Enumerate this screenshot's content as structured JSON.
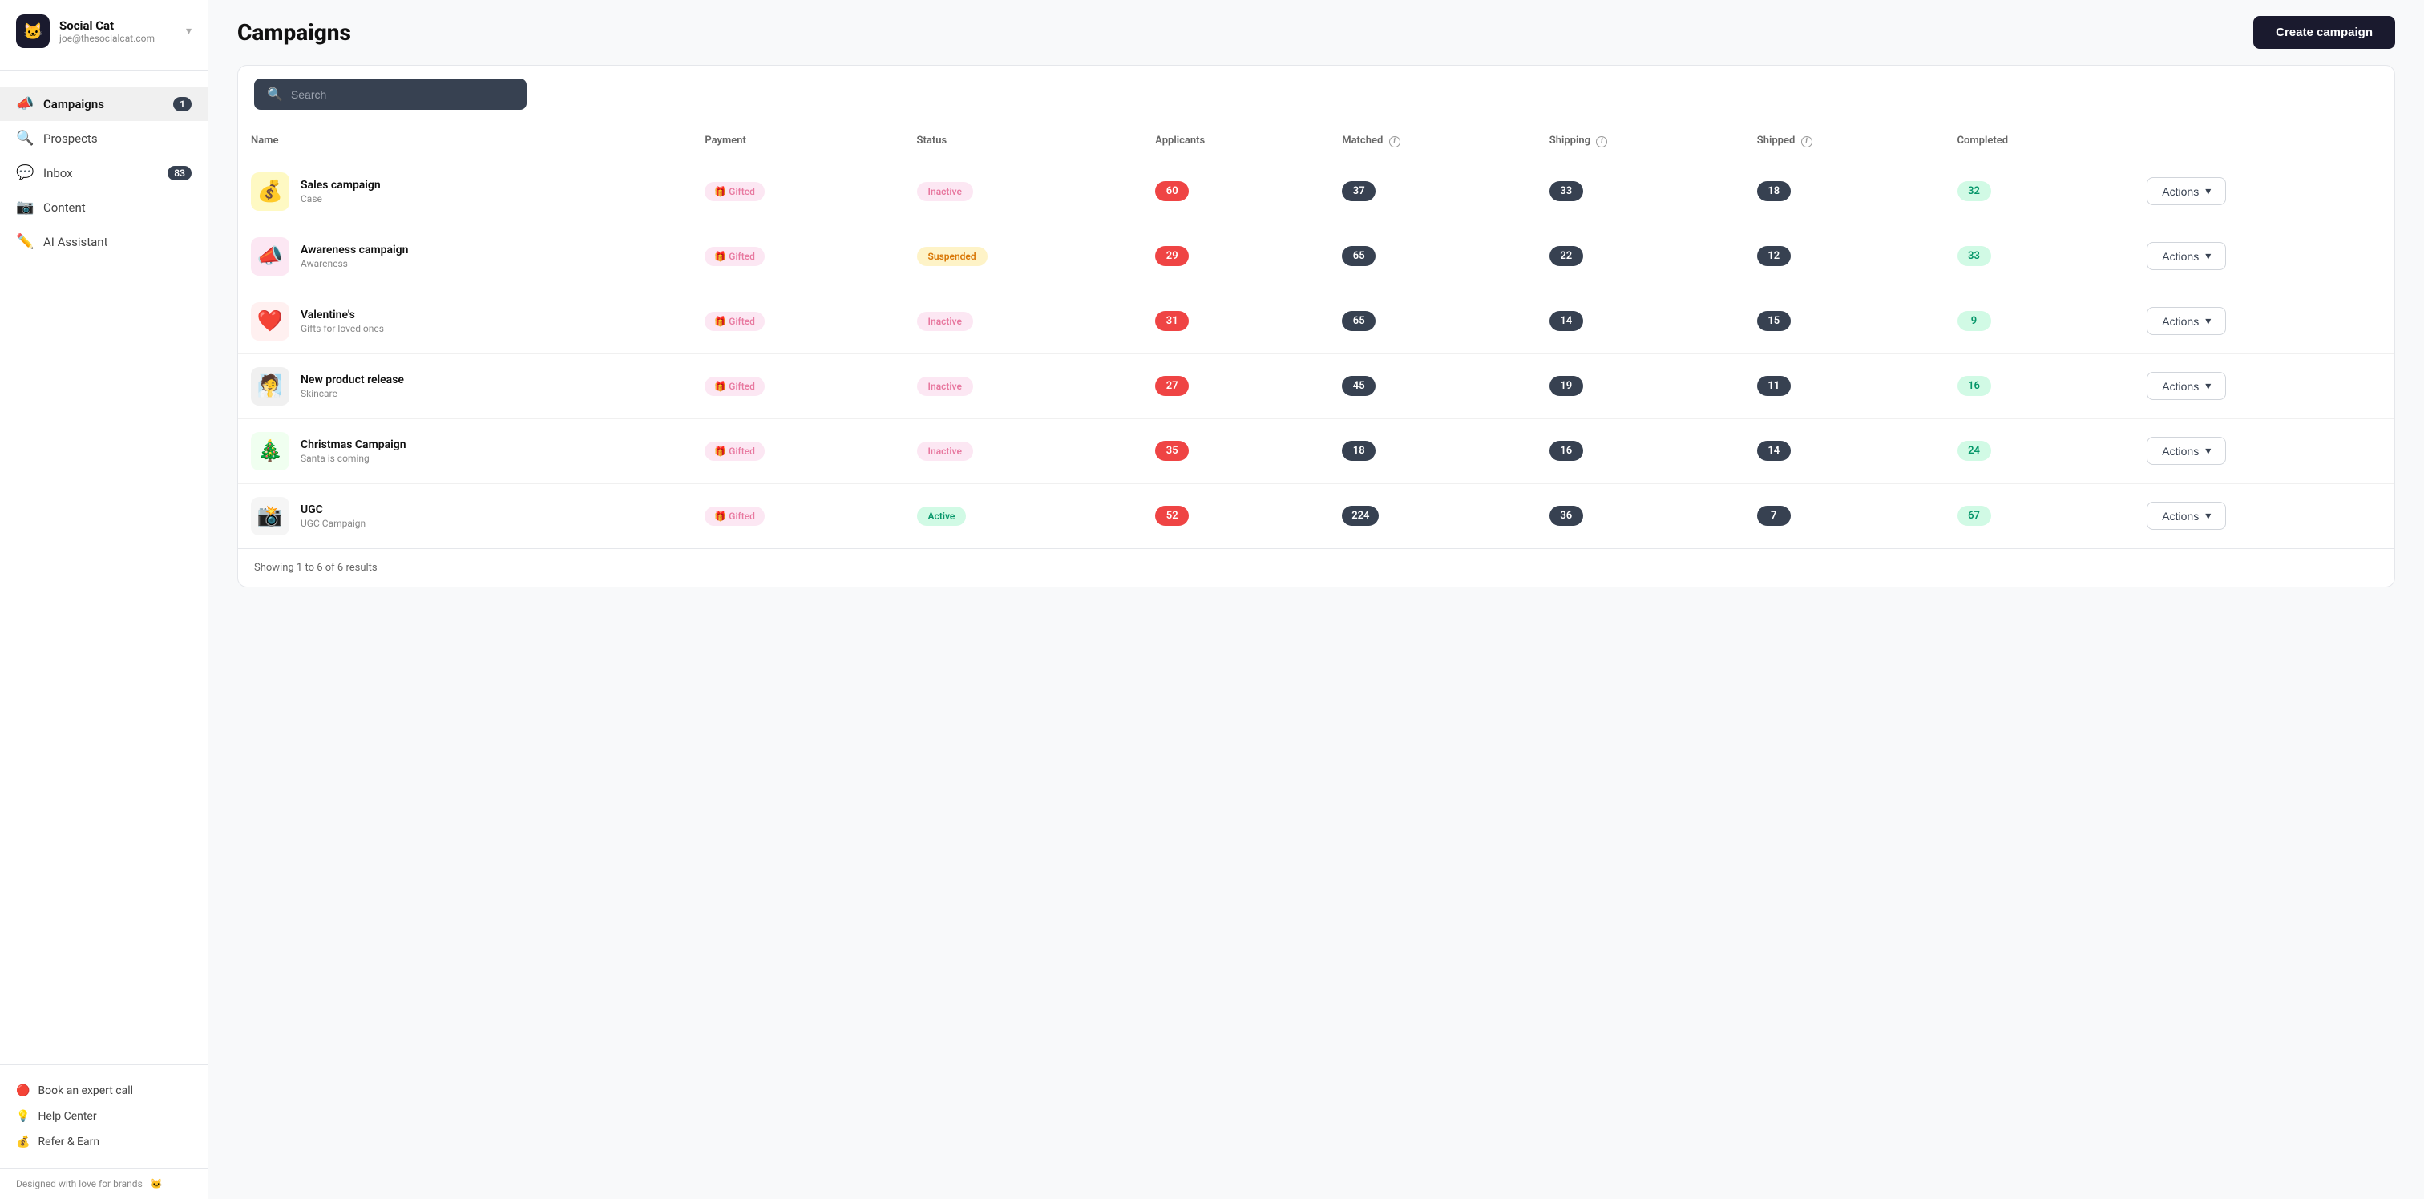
{
  "app": {
    "name": "Social Cat",
    "email": "joe@thesocialcat.com",
    "logo_emoji": "🐱"
  },
  "sidebar": {
    "nav_items": [
      {
        "id": "campaigns",
        "label": "Campaigns",
        "icon": "📣",
        "badge": "1",
        "active": true
      },
      {
        "id": "prospects",
        "label": "Prospects",
        "icon": "🔍",
        "badge": null,
        "active": false
      },
      {
        "id": "inbox",
        "label": "Inbox",
        "icon": "💬",
        "badge": "83",
        "active": false
      },
      {
        "id": "content",
        "label": "Content",
        "icon": "📷",
        "badge": null,
        "active": false
      },
      {
        "id": "ai-assistant",
        "label": "AI Assistant",
        "icon": "✏️",
        "badge": null,
        "active": false
      }
    ],
    "bottom_items": [
      {
        "id": "book-call",
        "label": "Book an expert call",
        "icon": "🔴"
      },
      {
        "id": "help",
        "label": "Help Center",
        "icon": "💡"
      },
      {
        "id": "refer",
        "label": "Refer & Earn",
        "icon": "💰"
      }
    ],
    "footer_text": "Designed with love for brands",
    "footer_icon": "🐱"
  },
  "header": {
    "title": "Campaigns",
    "create_btn_label": "Create campaign"
  },
  "search": {
    "placeholder": "Search"
  },
  "table": {
    "columns": [
      {
        "id": "name",
        "label": "Name"
      },
      {
        "id": "payment",
        "label": "Payment"
      },
      {
        "id": "status",
        "label": "Status"
      },
      {
        "id": "applicants",
        "label": "Applicants"
      },
      {
        "id": "matched",
        "label": "Matched",
        "info": true
      },
      {
        "id": "shipping",
        "label": "Shipping",
        "info": true
      },
      {
        "id": "shipped",
        "label": "Shipped",
        "info": true
      },
      {
        "id": "completed",
        "label": "Completed"
      },
      {
        "id": "actions",
        "label": ""
      }
    ],
    "rows": [
      {
        "id": 1,
        "emoji": "💰",
        "emoji_bg": "#fef9c3",
        "name": "Sales campaign",
        "subtitle": "Case",
        "payment": "Gifted",
        "status": "Inactive",
        "status_type": "inactive",
        "applicants": 60,
        "matched": 37,
        "shipping": 33,
        "shipped": 18,
        "completed": 32
      },
      {
        "id": 2,
        "emoji": "📣",
        "emoji_bg": "#fce7f3",
        "name": "Awareness campaign",
        "subtitle": "Awareness",
        "payment": "Gifted",
        "status": "Suspended",
        "status_type": "suspended",
        "applicants": 29,
        "matched": 65,
        "shipping": 22,
        "shipped": 12,
        "completed": 33
      },
      {
        "id": 3,
        "emoji": "❤️",
        "emoji_bg": "#fff0f0",
        "name": "Valentine's",
        "subtitle": "Gifts for loved ones",
        "payment": "Gifted",
        "status": "Inactive",
        "status_type": "inactive",
        "applicants": 31,
        "matched": 65,
        "shipping": 14,
        "shipped": 15,
        "completed": 9
      },
      {
        "id": 4,
        "emoji": "🧖",
        "emoji_bg": "#f0f0f0",
        "name": "New product release",
        "subtitle": "Skincare",
        "payment": "Gifted",
        "status": "Inactive",
        "status_type": "inactive",
        "applicants": 27,
        "matched": 45,
        "shipping": 19,
        "shipped": 11,
        "completed": 16
      },
      {
        "id": 5,
        "emoji": "🎄",
        "emoji_bg": "#f0fff0",
        "name": "Christmas Campaign",
        "subtitle": "Santa is coming",
        "payment": "Gifted",
        "status": "Inactive",
        "status_type": "inactive",
        "applicants": 35,
        "matched": 18,
        "shipping": 16,
        "shipped": 14,
        "completed": 24
      },
      {
        "id": 6,
        "emoji": "📸",
        "emoji_bg": "#f5f5f5",
        "name": "UGC",
        "subtitle": "UGC Campaign",
        "payment": "Gifted",
        "status": "Active",
        "status_type": "active",
        "applicants": 52,
        "matched": 224,
        "shipping": 36,
        "shipped": 7,
        "completed": 67
      }
    ],
    "footer_text": "Showing 1 to 6 of 6 results",
    "actions_label": "Actions"
  }
}
